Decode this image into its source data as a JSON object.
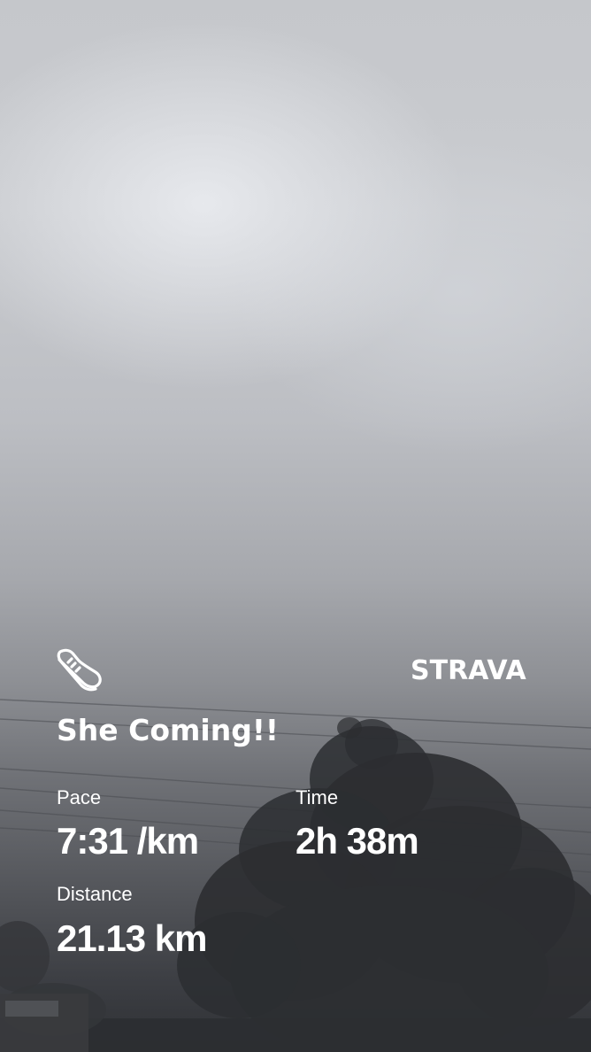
{
  "activity": {
    "icon": "running-shoe-icon",
    "brand": "STRAVA",
    "title": "She Coming!!"
  },
  "stats": {
    "pace": {
      "label": "Pace",
      "value": "7:31 /km"
    },
    "time": {
      "label": "Time",
      "value": "2h 38m"
    },
    "distance": {
      "label": "Distance",
      "value": "21.13 km"
    }
  },
  "colors": {
    "text": "#ffffff",
    "sky_top": "#c5c7cb",
    "sky_bottom": "#2e3034"
  }
}
